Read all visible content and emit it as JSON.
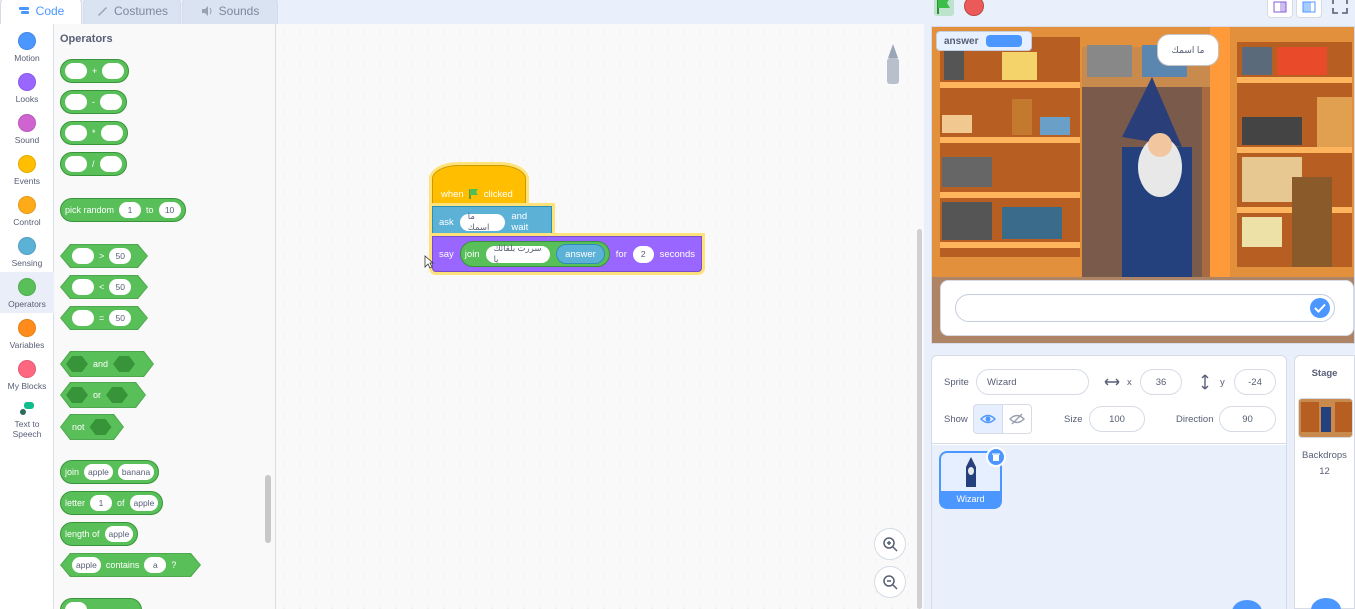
{
  "tabs": [
    {
      "label": "Code",
      "icon": "code-icon",
      "active": true
    },
    {
      "label": "Costumes",
      "icon": "brush-icon",
      "active": false
    },
    {
      "label": "Sounds",
      "icon": "speaker-icon",
      "active": false
    }
  ],
  "categories": [
    {
      "label": "Motion",
      "color": "#4c97ff"
    },
    {
      "label": "Looks",
      "color": "#9966ff"
    },
    {
      "label": "Sound",
      "color": "#cf63cf"
    },
    {
      "label": "Events",
      "color": "#ffbf00"
    },
    {
      "label": "Control",
      "color": "#ffab19"
    },
    {
      "label": "Sensing",
      "color": "#5cb1d6"
    },
    {
      "label": "Operators",
      "color": "#59c059",
      "selected": true
    },
    {
      "label": "Variables",
      "color": "#ff8c1a"
    },
    {
      "label": "My Blocks",
      "color": "#ff6680"
    },
    {
      "label_line1": "Text to",
      "label_line2": "Speech",
      "icon": "text-to-speech-icon"
    }
  ],
  "palette": {
    "title": "Operators",
    "op_plus": "+",
    "op_minus": "-",
    "op_times": "*",
    "op_div": "/",
    "pick_random": "pick random",
    "pr_from": "1",
    "pr_to_label": "to",
    "pr_to": "10",
    "gt": ">",
    "lt": "<",
    "eq": "=",
    "cmp_value": "50",
    "and": "and",
    "or": "or",
    "not": "not",
    "join": "join",
    "join_a": "apple",
    "join_b": "banana",
    "letter": "letter",
    "letter_n": "1",
    "letter_of": "of",
    "letter_word": "apple",
    "length_of": "length of",
    "length_word": "apple",
    "contains_a": "apple",
    "contains": "contains",
    "contains_b": "a",
    "contains_q": "?"
  },
  "script": {
    "when": "when",
    "clicked": "clicked",
    "ask": "ask",
    "ask_text": "ما اسمك",
    "and_wait": "and wait",
    "say": "say",
    "join": "join",
    "join_text": "سررت بلقائك يا",
    "answer": "answer",
    "for": "for",
    "seconds_value": "2",
    "seconds": "seconds"
  },
  "stage": {
    "monitor_label": "answer",
    "bubble_text": "ما اسمك",
    "input_placeholder": ""
  },
  "sprite_info": {
    "sprite_label": "Sprite",
    "sprite_name": "Wizard",
    "x_label": "x",
    "x": "36",
    "y_label": "y",
    "y": "-24",
    "show_label": "Show",
    "size_label": "Size",
    "size": "100",
    "direction_label": "Direction",
    "direction": "90"
  },
  "sprites": [
    {
      "name": "Wizard"
    }
  ],
  "stage_pane": {
    "title": "Stage",
    "backdrops_label": "Backdrops",
    "backdrops_count": "12"
  },
  "colors": {
    "accent": "#4c97ff",
    "operators": "#59c059",
    "events": "#ffbf00",
    "sensing": "#5cb1d6",
    "looks": "#9966ff"
  }
}
